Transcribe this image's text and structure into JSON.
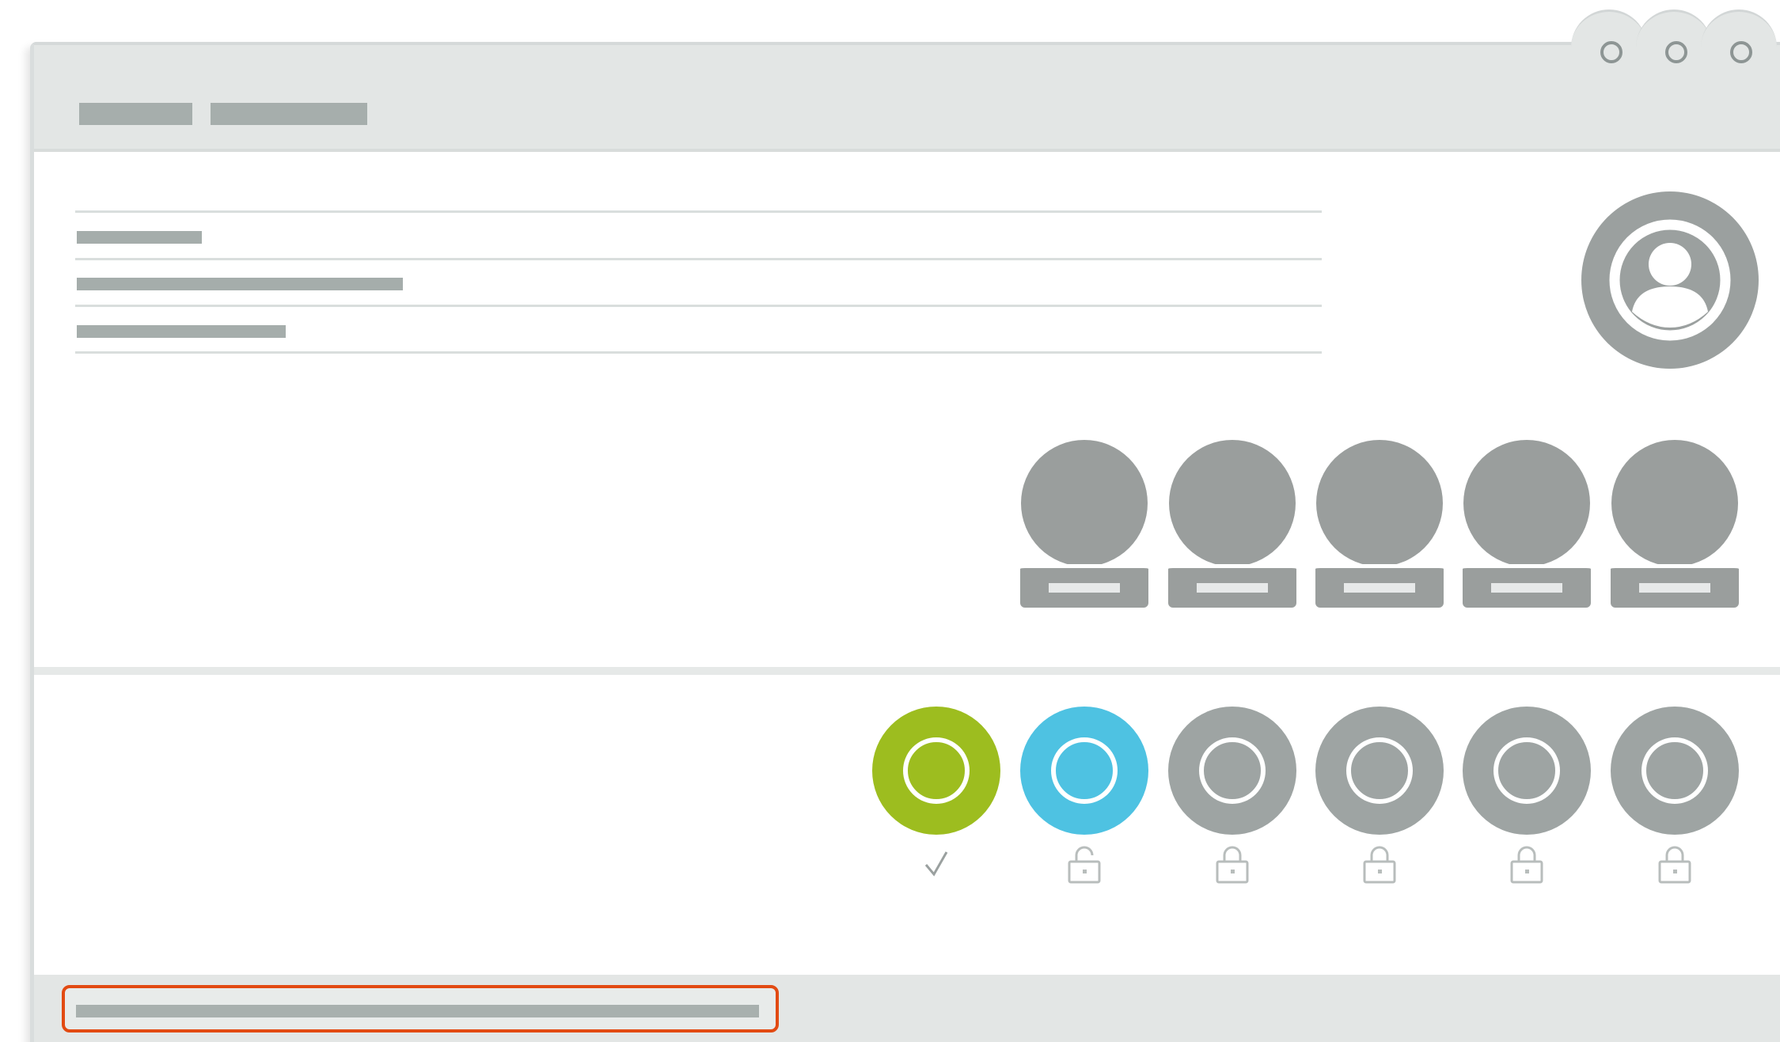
{
  "window": {
    "controls": [
      "minimize-button",
      "maximize-button",
      "close-button"
    ]
  },
  "titlebar": {
    "tabs": [
      "tab-1",
      "tab-2"
    ]
  },
  "info_list": {
    "rows": [
      "row-1",
      "row-2",
      "row-3"
    ]
  },
  "profile": {
    "avatar_icon": "user-avatar-icon"
  },
  "members": {
    "count": 5,
    "icon": "person-placeholder-icon"
  },
  "steps": [
    {
      "state": "completed",
      "color": "#9dbd1f",
      "status_icon": "check-icon"
    },
    {
      "state": "unlocked",
      "color": "#4ec2e2",
      "status_icon": "lock-open-icon"
    },
    {
      "state": "locked",
      "color": "#9ea4a3",
      "status_icon": "lock-icon"
    },
    {
      "state": "locked",
      "color": "#9ea4a3",
      "status_icon": "lock-icon"
    },
    {
      "state": "locked",
      "color": "#9ea4a3",
      "status_icon": "lock-icon"
    },
    {
      "state": "locked",
      "color": "#9ea4a3",
      "status_icon": "lock-icon"
    }
  ],
  "footer": {
    "highlight_color": "#e24a12"
  },
  "colors": {
    "chrome": "#e3e6e5",
    "placeholder": "#a6aeac",
    "icon_grey": "#9a9e9d",
    "accent_green": "#9dbd1f",
    "accent_blue": "#4ec2e2",
    "highlight_orange": "#e24a12"
  }
}
